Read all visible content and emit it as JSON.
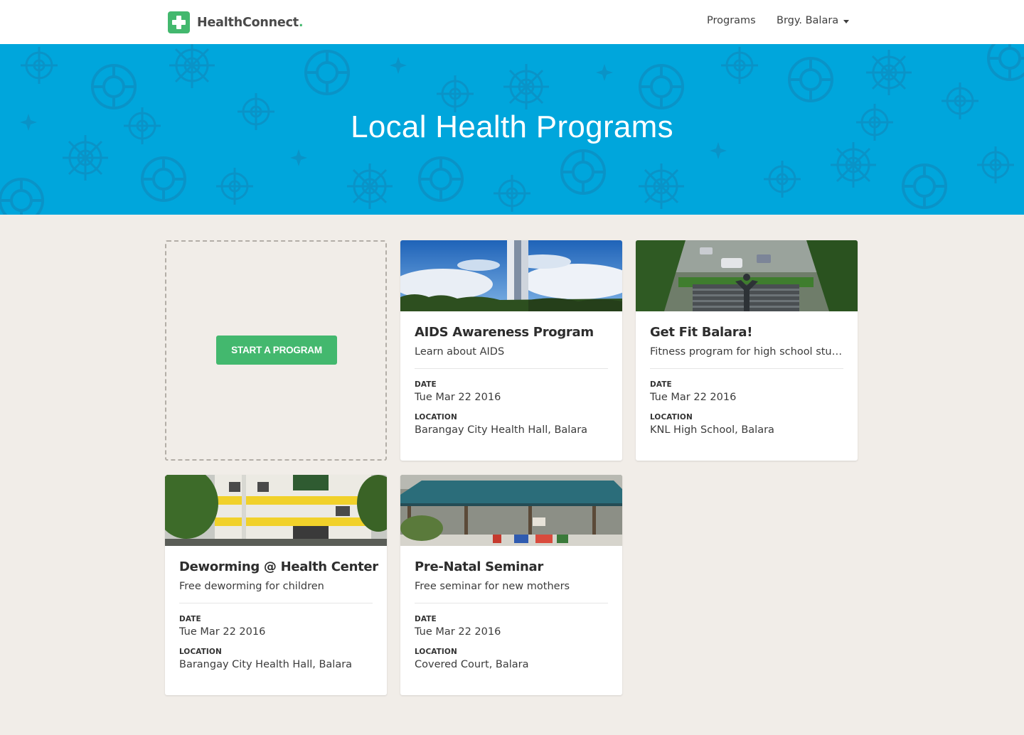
{
  "brand": {
    "name": "HealthConnect",
    "dot": ".",
    "logo_icon": "medical-cross-icon"
  },
  "nav": {
    "programs_label": "Programs",
    "barangay_label": "Brgy. Balara"
  },
  "hero": {
    "title": "Local Health Programs"
  },
  "actions": {
    "start_label": "START A PROGRAM"
  },
  "labels": {
    "date": "DATE",
    "location": "LOCATION"
  },
  "colors": {
    "accent_green": "#43b86e",
    "hero_blue": "#00a6dc",
    "page_bg": "#f1ede8"
  },
  "programs": [
    {
      "title": "AIDS Awareness Program",
      "description": "Learn about AIDS",
      "date": "Tue Mar 22 2016",
      "location": "Barangay City Health Hall, Balara"
    },
    {
      "title": "Get Fit Balara!",
      "description": "Fitness program for high school students",
      "date": "Tue Mar 22 2016",
      "location": "KNL High School, Balara"
    },
    {
      "title": "Deworming @ Health Center",
      "description": "Free deworming for children",
      "date": "Tue Mar 22 2016",
      "location": "Barangay City Health Hall, Balara"
    },
    {
      "title": "Pre-Natal Seminar",
      "description": "Free seminar for new mothers",
      "date": "Tue Mar 22 2016",
      "location": "Covered Court, Balara"
    }
  ]
}
